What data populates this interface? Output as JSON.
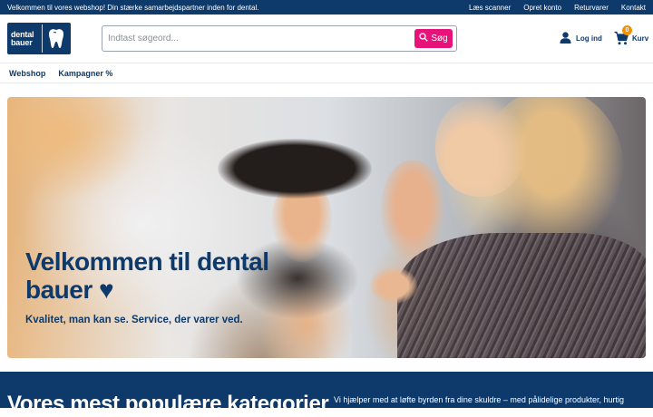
{
  "topbar": {
    "welcome": "Velkommen til vores webshop! Din stærke samarbejdspartner inden for dental.",
    "links": [
      "Læs scanner",
      "Opret konto",
      "Returvarer",
      "Kontakt"
    ]
  },
  "header": {
    "logo_text": [
      "dental",
      "bauer"
    ],
    "search_placeholder": "Indtast søgeord...",
    "search_button": "Søg",
    "login_label": "Log ind",
    "cart_label": "Kurv",
    "cart_count": "0"
  },
  "nav": {
    "items": [
      "Webshop",
      "Kampagner %"
    ]
  },
  "hero": {
    "title": "Velkommen til dental bauer ♥",
    "subtitle": "Kvalitet, man kan se. Service, der varer ved."
  },
  "section": {
    "title": "Vores mest populære kategorier",
    "intro": "Vi hjælper med at løfte byrden fra dine skuldre – med pålidelige produkter, hurtig"
  },
  "colors": {
    "brand": "#0d3a6b",
    "accent": "#e7127a",
    "badge": "#f39200"
  },
  "icons": [
    "tooth-icon",
    "search-icon",
    "user-icon",
    "cart-icon"
  ]
}
